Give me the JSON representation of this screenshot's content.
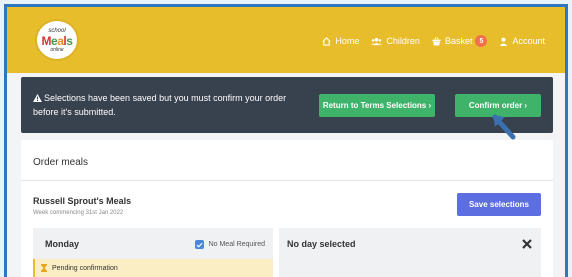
{
  "logo": {
    "top": "school",
    "letters": [
      "M",
      "e",
      "a",
      "l",
      "s"
    ],
    "bottom": "online"
  },
  "nav": {
    "home": "Home",
    "children": "Children",
    "basket": "Basket",
    "basket_count": "5",
    "account": "Account"
  },
  "alert": {
    "message": "Selections have been saved but you must confirm your order before it's submitted.",
    "return_button": "Return to Terms Selections ›",
    "confirm_button": "Confirm order ›"
  },
  "order": {
    "title": "Order meals",
    "child_meals": "Russell Sprout's Meals",
    "week": "Week commencing 31st Jan 2022",
    "save_button": "Save selections",
    "day": "Monday",
    "no_meal_label": "No Meal Required",
    "no_meal_checked": true,
    "pending": "Pending confirmation",
    "no_day": "No day selected"
  },
  "colors": {
    "header": "#e7bd2c",
    "alert": "#38414e",
    "green_button": "#3fb36a",
    "save_button": "#5c6ee0",
    "badge": "#f0714b"
  }
}
